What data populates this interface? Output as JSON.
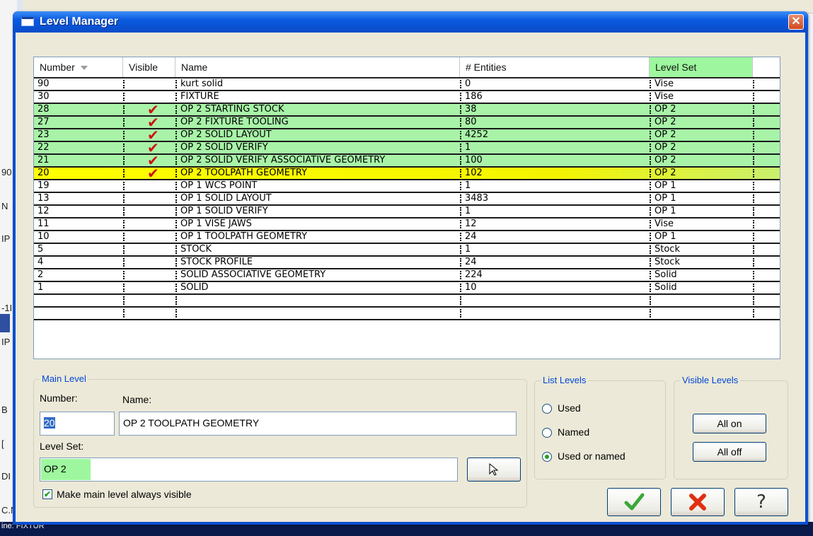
{
  "dialog": {
    "title": "Level Manager"
  },
  "background_fragments": [
    "90",
    "N",
    "IP",
    "-1I",
    "IP",
    "B",
    "[",
    "DI",
    "C.N",
    "ine: FIXTUR"
  ],
  "table": {
    "columns": {
      "number": "Number",
      "visible": "Visible",
      "name": "Name",
      "entities": "# Entities",
      "level_set": "Level Set"
    },
    "rows": [
      {
        "number": "90",
        "visible": false,
        "name": "kurt solid",
        "entities": "0",
        "level_set": "Vise",
        "highlight": "none"
      },
      {
        "number": "30",
        "visible": false,
        "name": "FIXTURE",
        "entities": "186",
        "level_set": "Vise",
        "highlight": "none"
      },
      {
        "number": "28",
        "visible": true,
        "name": "OP 2 STARTING STOCK",
        "entities": "38",
        "level_set": "OP 2",
        "highlight": "green"
      },
      {
        "number": "27",
        "visible": true,
        "name": "OP 2 FIXTURE TOOLING",
        "entities": "80",
        "level_set": "OP 2",
        "highlight": "green"
      },
      {
        "number": "23",
        "visible": true,
        "name": "OP 2 SOLID LAYOUT",
        "entities": "4252",
        "level_set": "OP 2",
        "highlight": "green"
      },
      {
        "number": "22",
        "visible": true,
        "name": "OP 2 SOLID VERIFY",
        "entities": "1",
        "level_set": "OP 2",
        "highlight": "green"
      },
      {
        "number": "21",
        "visible": true,
        "name": "OP 2 SOLID VERIFY ASSOCIATIVE GEOMETRY",
        "entities": "100",
        "level_set": "OP 2",
        "highlight": "green"
      },
      {
        "number": "20",
        "visible": true,
        "name": "OP 2 TOOLPATH GEOMETRY",
        "entities": "102",
        "level_set": "OP 2",
        "highlight": "selected"
      },
      {
        "number": "19",
        "visible": false,
        "name": "OP 1 WCS POINT",
        "entities": "1",
        "level_set": "OP 1",
        "highlight": "none"
      },
      {
        "number": "13",
        "visible": false,
        "name": "OP 1 SOLID LAYOUT",
        "entities": "3483",
        "level_set": "OP 1",
        "highlight": "none"
      },
      {
        "number": "12",
        "visible": false,
        "name": "OP 1 SOLID VERIFY",
        "entities": "1",
        "level_set": "OP 1",
        "highlight": "none"
      },
      {
        "number": "11",
        "visible": false,
        "name": "OP 1 VISE JAWS",
        "entities": "12",
        "level_set": "Vise",
        "highlight": "none"
      },
      {
        "number": "10",
        "visible": false,
        "name": "OP 1 TOOLPATH GEOMETRY",
        "entities": "24",
        "level_set": "OP 1",
        "highlight": "none"
      },
      {
        "number": "5",
        "visible": false,
        "name": "STOCK",
        "entities": "1",
        "level_set": "Stock",
        "highlight": "none"
      },
      {
        "number": "4",
        "visible": false,
        "name": "STOCK PROFILE",
        "entities": "24",
        "level_set": "Stock",
        "highlight": "none"
      },
      {
        "number": "2",
        "visible": false,
        "name": "SOLID ASSOCIATIVE GEOMETRY",
        "entities": "224",
        "level_set": "Solid",
        "highlight": "none"
      },
      {
        "number": "1",
        "visible": false,
        "name": "SOLID",
        "entities": "10",
        "level_set": "Solid",
        "highlight": "none"
      }
    ]
  },
  "main_level": {
    "legend": "Main Level",
    "number_label": "Number:",
    "number_value": "20",
    "name_label": "Name:",
    "name_value": "OP 2 TOOLPATH GEOMETRY",
    "level_set_label": "Level Set:",
    "level_set_value": "OP 2",
    "always_visible_label": "Make main level always visible",
    "always_visible_checked": true
  },
  "list_levels": {
    "legend": "List Levels",
    "options": [
      "Used",
      "Named",
      "Used or named"
    ],
    "selected": "Used or named"
  },
  "visible_levels": {
    "legend": "Visible Levels",
    "all_on": "All on",
    "all_off": "All off"
  },
  "icons": {
    "ok": "checkmark-icon",
    "cancel": "x-icon",
    "help": "question-icon",
    "pick": "pointer-icon"
  },
  "colors": {
    "green_highlight": "#a8f3a8",
    "selected_highlight": "#ffff00",
    "check_red": "#d01010"
  }
}
